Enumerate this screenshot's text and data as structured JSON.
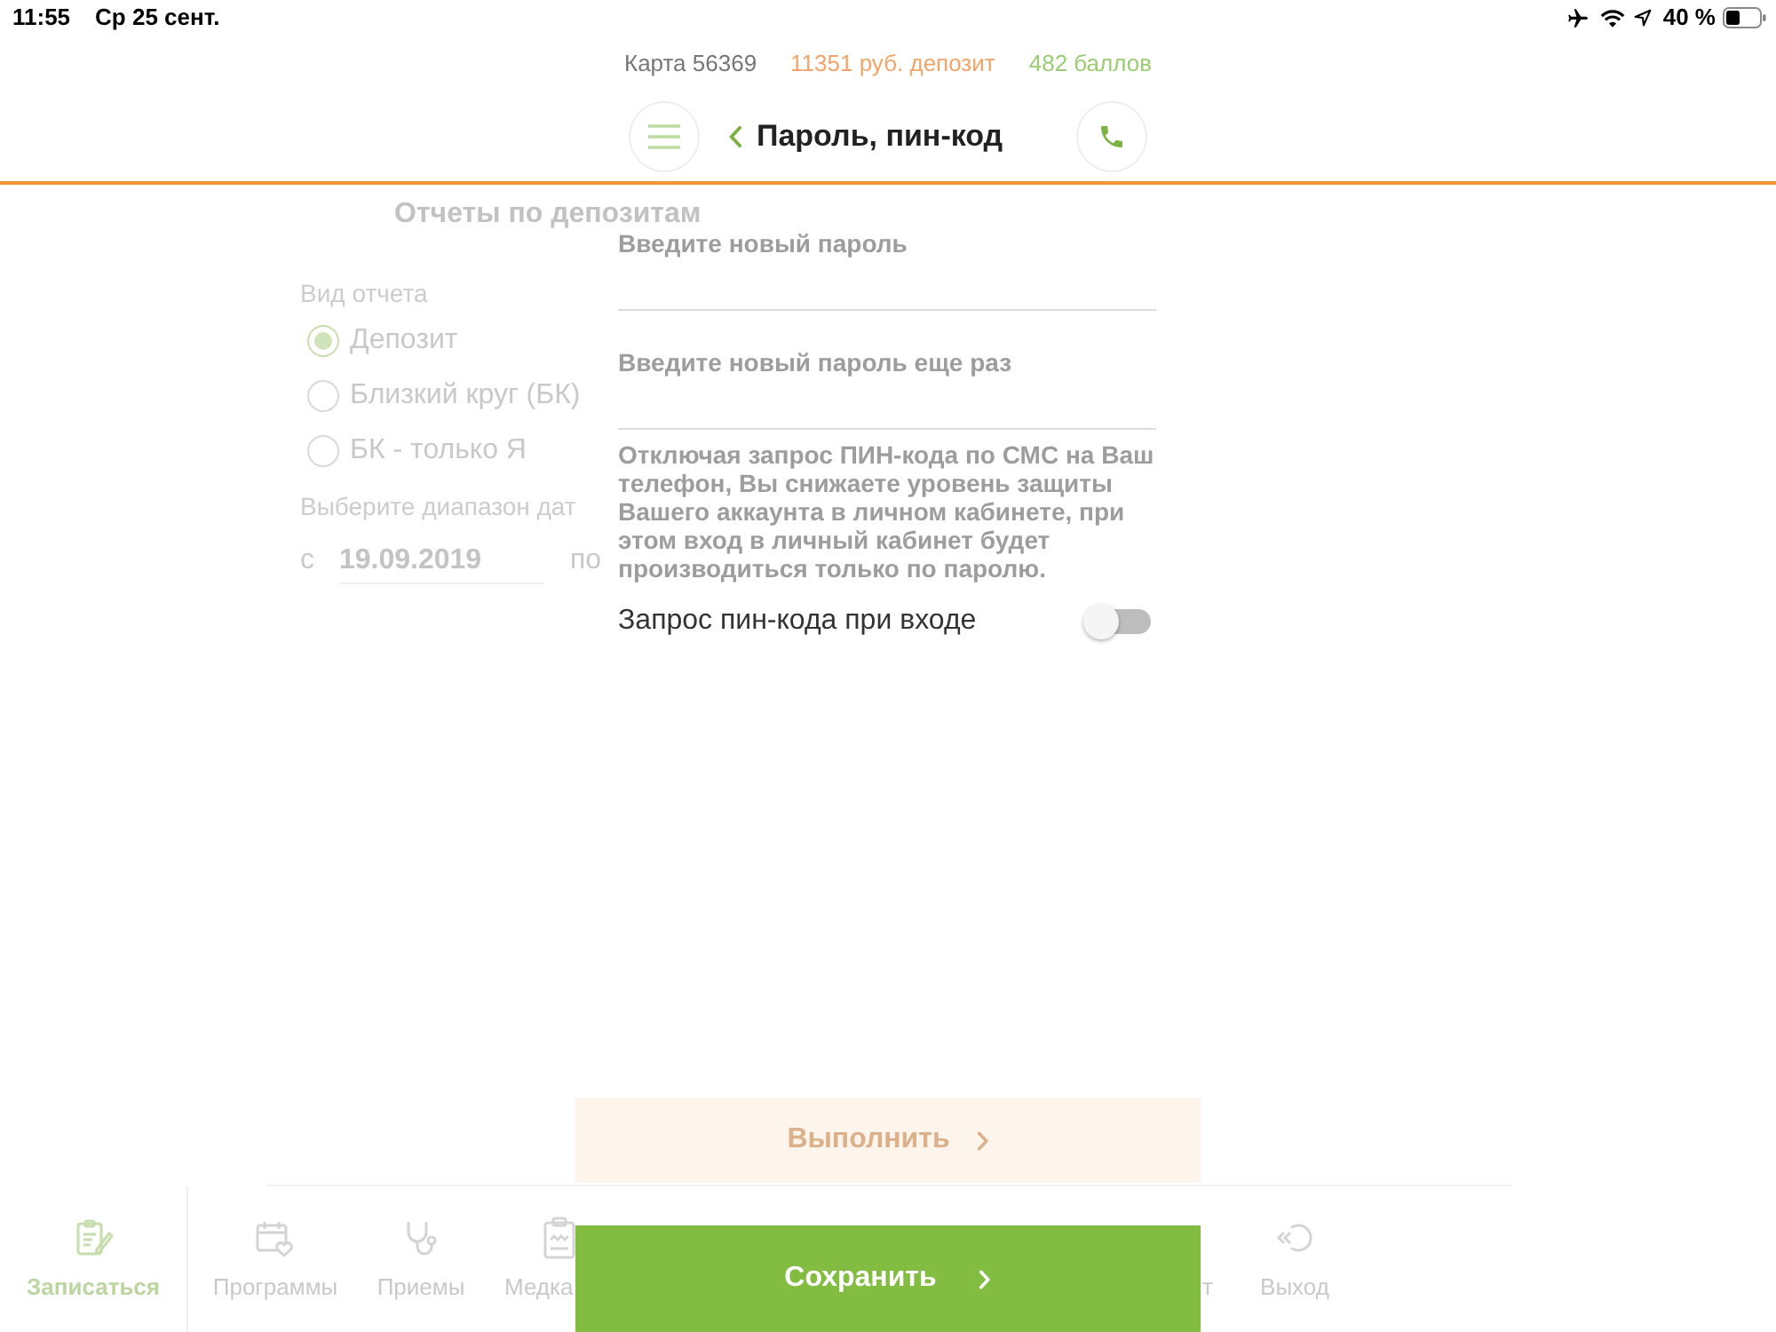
{
  "status_bar": {
    "time": "11:55",
    "date": "Ср 25 сент.",
    "battery": "40 %"
  },
  "account_bar": {
    "card": "Карта 56369",
    "deposit": "11351 руб. депозит",
    "points": "482 баллов"
  },
  "header": {
    "title": "Пароль, пин-код"
  },
  "background_screen": {
    "title": "Отчеты по депозитам",
    "report_type_label": "Вид отчета",
    "report_types": [
      {
        "label": "Депозит",
        "selected": true
      },
      {
        "label": "Близкий круг (БК)",
        "selected": false
      },
      {
        "label": "БК - только Я",
        "selected": false
      }
    ],
    "date_range_label": "Выберите диапазон дат",
    "date_from": {
      "prefix": "с",
      "value": "19.09.2019"
    },
    "date_to": {
      "prefix": "по"
    },
    "run_button": "Выполнить",
    "nav_items": [
      {
        "label": "Записаться",
        "selected": true
      },
      {
        "label": "Программы",
        "selected": false
      },
      {
        "label": "Приемы",
        "selected": false
      },
      {
        "label": "Медка",
        "selected": false
      },
      {
        "label": "т",
        "selected": false
      },
      {
        "label": "Выход",
        "selected": false
      }
    ]
  },
  "form": {
    "fields": [
      {
        "label": "Введите новый пароль"
      },
      {
        "label": "Введите новый пароль еще раз"
      }
    ],
    "notice": "Отключая запрос ПИН-кода по СМС на Ваш телефон, Вы снижаете уровень защиты Вашего аккаунта в личном кабинете, при этом вход в личный кабинет будет производиться только по паролю.",
    "pin_toggle": {
      "label": "Запрос пин-кода при входе",
      "on": false
    },
    "save_button": "Сохранить"
  }
}
